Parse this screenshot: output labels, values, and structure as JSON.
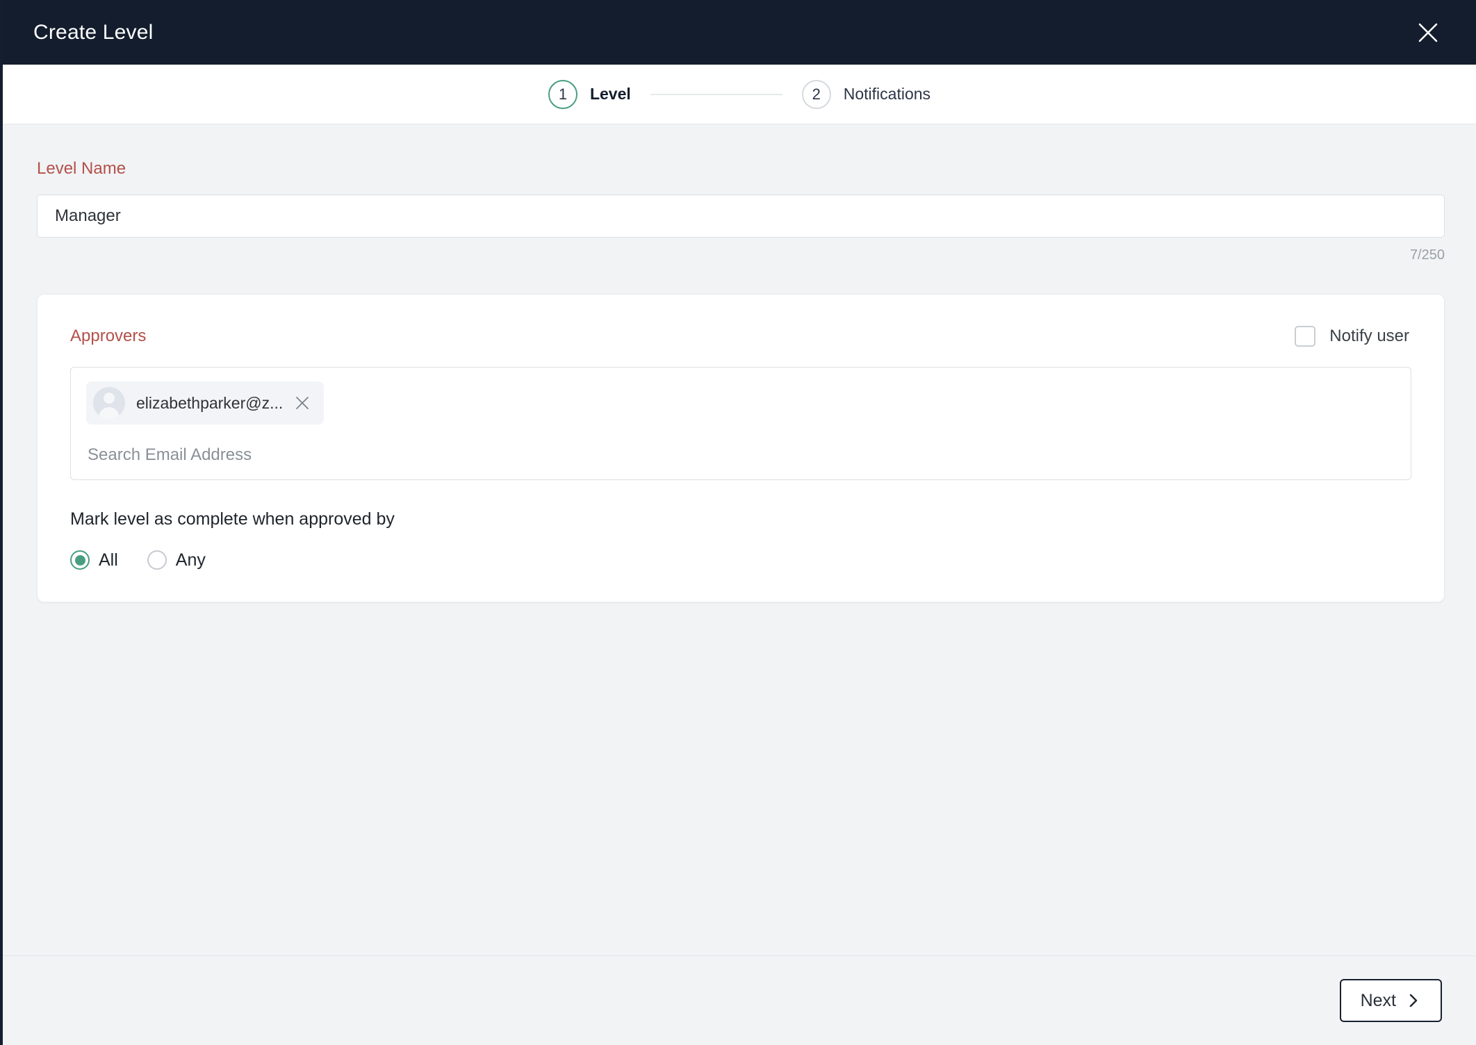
{
  "header": {
    "title": "Create Level",
    "close_icon": "close-icon"
  },
  "stepper": {
    "steps": [
      {
        "number": "1",
        "label": "Level",
        "state": "active"
      },
      {
        "number": "2",
        "label": "Notifications",
        "state": "inactive"
      }
    ]
  },
  "level_name": {
    "label": "Level Name",
    "value": "Manager",
    "placeholder": "",
    "char_counter": "7/250"
  },
  "approvers": {
    "title": "Approvers",
    "notify_user": {
      "label": "Notify user",
      "checked": false
    },
    "chips": [
      {
        "text": "elizabethparker@z...",
        "avatar_icon": "user-avatar-icon",
        "remove_icon": "close-icon"
      }
    ],
    "search_placeholder": "Search Email Address",
    "search_value": "",
    "completion": {
      "label": "Mark level as complete when approved by",
      "options": [
        {
          "label": "All",
          "selected": true
        },
        {
          "label": "Any",
          "selected": false
        }
      ]
    }
  },
  "footer": {
    "next_label": "Next",
    "next_icon": "chevron-right-icon"
  },
  "colors": {
    "header_bg": "#141d2d",
    "accent_green": "#4a9e80",
    "label_red": "#b35049",
    "body_bg": "#f1f3f5",
    "border": "#dcdfe3"
  }
}
